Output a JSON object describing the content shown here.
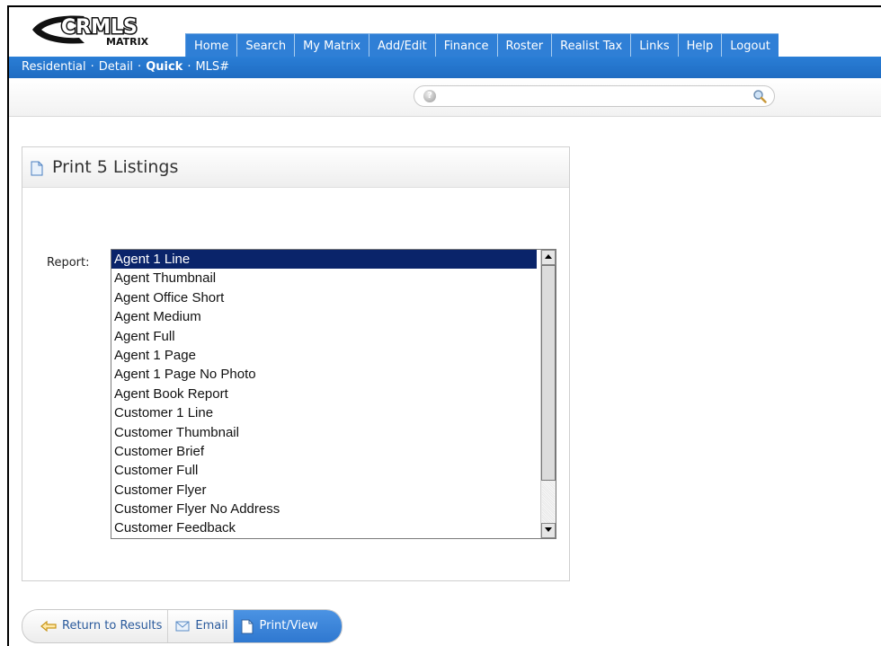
{
  "brand": {
    "logo_line1": "CRMLS",
    "logo_line2": "MATRIX"
  },
  "nav": {
    "items": [
      {
        "label": "Home"
      },
      {
        "label": "Search"
      },
      {
        "label": "My Matrix"
      },
      {
        "label": "Add/Edit"
      },
      {
        "label": "Finance"
      },
      {
        "label": "Roster"
      },
      {
        "label": "Realist Tax"
      },
      {
        "label": "Links"
      },
      {
        "label": "Help"
      },
      {
        "label": "Logout"
      }
    ]
  },
  "subnav": {
    "items": [
      {
        "label": "Residential"
      },
      {
        "label": "Detail"
      },
      {
        "label": "Quick",
        "active": true
      },
      {
        "label": "MLS#"
      }
    ],
    "separator": "·"
  },
  "search": {
    "value": "",
    "placeholder": "",
    "help_icon": "help-icon",
    "search_icon": "magnifier-icon"
  },
  "panel": {
    "title": "Print 5 Listings",
    "report_label": "Report:",
    "report_options": [
      "Agent 1 Line",
      "Agent Thumbnail",
      "Agent Office Short",
      "Agent Medium",
      "Agent Full",
      "Agent 1 Page",
      "Agent 1 Page No Photo",
      "Agent Book Report",
      "Customer 1 Line",
      "Customer Thumbnail",
      "Customer Brief",
      "Customer Full",
      "Customer Flyer",
      "Customer Flyer No Address",
      "Customer Feedback"
    ],
    "selected_option": "Agent 1 Line"
  },
  "actions": {
    "return_label": "Return to Results",
    "email_label": "Email",
    "print_label": "Print/View"
  },
  "colors": {
    "nav_blue": "#2f7fd6",
    "selection": "#0a246a",
    "link": "#2a5a9c"
  }
}
